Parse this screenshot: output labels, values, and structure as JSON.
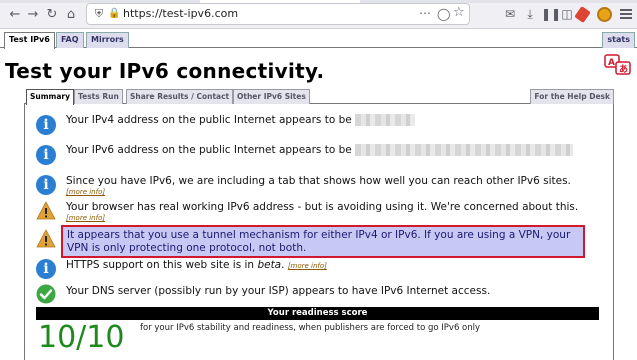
{
  "browser": {
    "url": "https://test-ipv6.com",
    "icons": {
      "back": "arrow-left-icon",
      "forward": "arrow-right-icon",
      "reload": "reload-icon",
      "home": "home-icon",
      "shield": "shield-icon",
      "lock": "lock-icon",
      "page_actions": "ellipsis-icon",
      "pocket": "pocket-icon",
      "bookmark": "star-icon",
      "mail": "mail-icon",
      "downloads": "download-icon",
      "library": "library-icon",
      "reader": "sidebar-icon",
      "extension1": "extension-icon",
      "extension2": "extension-icon",
      "menu": "hamburger-menu-icon"
    }
  },
  "site_tabs": {
    "items": [
      "Test IPv6",
      "FAQ",
      "Mirrors"
    ],
    "right": "stats"
  },
  "title": "Test your IPv6 connectivity.",
  "inner_tabs": {
    "items": [
      "Summary",
      "Tests Run",
      "Share Results / Contact",
      "Other IPv6 Sites"
    ],
    "right": "For the Help Desk"
  },
  "results": [
    {
      "icon": "info-icon",
      "text": "Your IPv4 address on the public Internet appears to be"
    },
    {
      "icon": "info-icon",
      "text": "Your IPv6 address on the public Internet appears to be"
    },
    {
      "icon": "info-icon",
      "text": "Since you have IPv6, we are including a tab that shows how well you can reach other IPv6 sites.",
      "more": "[more info]"
    },
    {
      "icon": "warning-icon",
      "text": "Your browser has real working IPv6 address - but is avoiding using it. We're concerned about this.",
      "more": "[more info]"
    },
    {
      "icon": "warning-icon",
      "line1": "It appears that you use a tunnel mechanism for either IPv4 or IPv6. If you are using a VPN, your",
      "line2": "VPN is only protecting one protocol, not both."
    },
    {
      "icon": "info-icon",
      "text_a": "HTTPS support on this web site is in ",
      "text_b": "beta",
      "text_c": ". ",
      "more": "[more info]"
    },
    {
      "icon": "check-icon",
      "text": "Your DNS server (possibly run by your ISP) appears to have IPv6 Internet access."
    }
  ],
  "score": {
    "heading": "Your readiness score",
    "value": "10/10",
    "note": "for your IPv6 stability and readiness, when publishers are forced to go IPv6 only"
  },
  "colors": {
    "info": "#2a7fd4",
    "warning": "#e0a03a",
    "ok": "#3da843",
    "highlight_bg": "#c8c8f4",
    "highlight_border": "#d0192e",
    "score": "#1e8a1e"
  }
}
